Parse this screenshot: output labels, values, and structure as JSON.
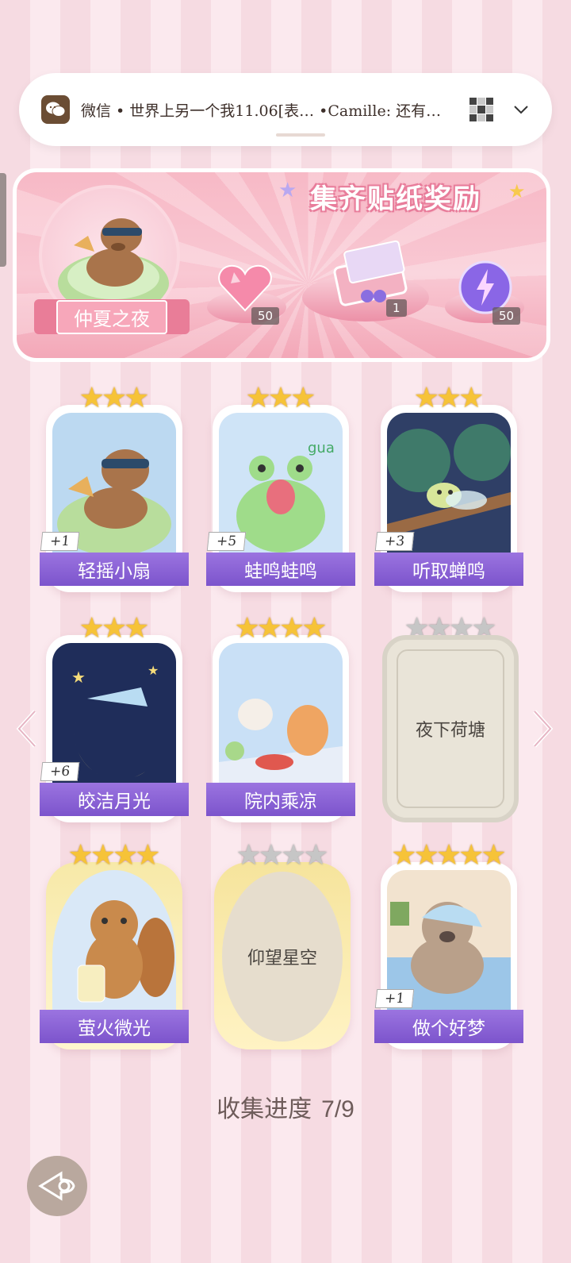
{
  "notification": {
    "text": "微信 • 世界上另一个我11.06[表… •Camille: 还有…",
    "icon": "wechat-icon"
  },
  "banner": {
    "title": "集齐贴纸奖励",
    "album_name": "仲夏之夜",
    "rewards": [
      {
        "name": "heart-gem-icon",
        "count": "50"
      },
      {
        "name": "gift-box-icon",
        "count": "1"
      },
      {
        "name": "lightning-orb-icon",
        "count": "50"
      }
    ]
  },
  "stickers": [
    {
      "label": "轻摇小扇",
      "stars": 3,
      "max_stars": 3,
      "collected": true,
      "plus": "+1"
    },
    {
      "label": "蛙鸣蛙鸣",
      "stars": 3,
      "max_stars": 3,
      "collected": true,
      "plus": "+5"
    },
    {
      "label": "听取蝉鸣",
      "stars": 3,
      "max_stars": 3,
      "collected": true,
      "plus": "+3"
    },
    {
      "label": "皎洁月光",
      "stars": 3,
      "max_stars": 3,
      "collected": true,
      "plus": "+6"
    },
    {
      "label": "院内乘凉",
      "stars": 4,
      "max_stars": 4,
      "collected": true,
      "plus": ""
    },
    {
      "label": "夜下荷塘",
      "stars": 0,
      "max_stars": 4,
      "collected": false,
      "plus": ""
    },
    {
      "label": "萤火微光",
      "stars": 4,
      "max_stars": 4,
      "collected": true,
      "plus": ""
    },
    {
      "label": "仰望星空",
      "stars": 0,
      "max_stars": 4,
      "collected": false,
      "plus": ""
    },
    {
      "label": "做个好梦",
      "stars": 5,
      "max_stars": 5,
      "collected": true,
      "plus": "+1"
    }
  ],
  "progress": {
    "label": "收集进度",
    "value": "7/9"
  }
}
